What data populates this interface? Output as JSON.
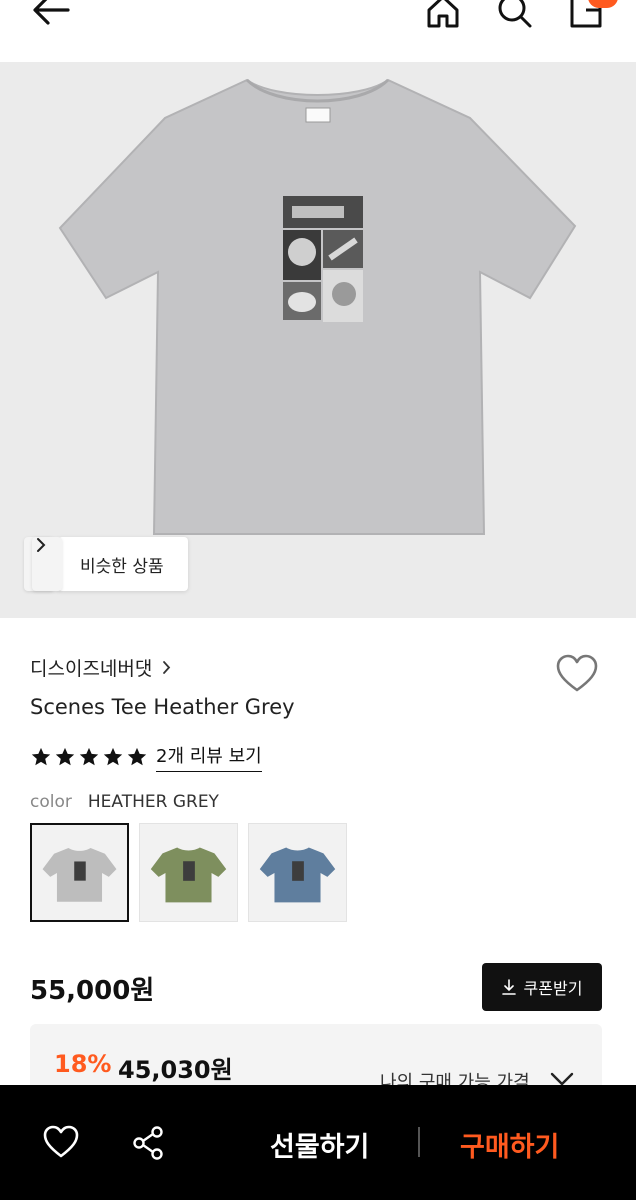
{
  "topbar": {
    "icons": [
      "back-arrow-icon",
      "home-icon",
      "search-icon",
      "shopping-bag-icon"
    ]
  },
  "hero": {
    "similar_label": "비슷한 상품"
  },
  "product": {
    "brand": "디스이즈네버댓",
    "title": "Scenes Tee Heather Grey",
    "rating_stars": 5,
    "review_link": "2개 리뷰 보기",
    "color_label": "color",
    "color_value": "HEATHER GREY",
    "swatches": [
      {
        "name": "grey",
        "color": "#bdbdbd",
        "selected": true
      },
      {
        "name": "olive",
        "color": "#7e8f5e",
        "selected": false
      },
      {
        "name": "blue",
        "color": "#5f7e9e",
        "selected": false
      }
    ],
    "price": "55,000원",
    "coupon_label": "쿠폰받기",
    "sale_percent": "18%",
    "sale_price": "45,030원",
    "sale_note": "나의 구매 가능 가격"
  },
  "bottombar": {
    "gift_label": "선물하기",
    "buy_label": "구매하기"
  },
  "colors": {
    "accent": "#ff5a1f",
    "dark": "#111111"
  }
}
